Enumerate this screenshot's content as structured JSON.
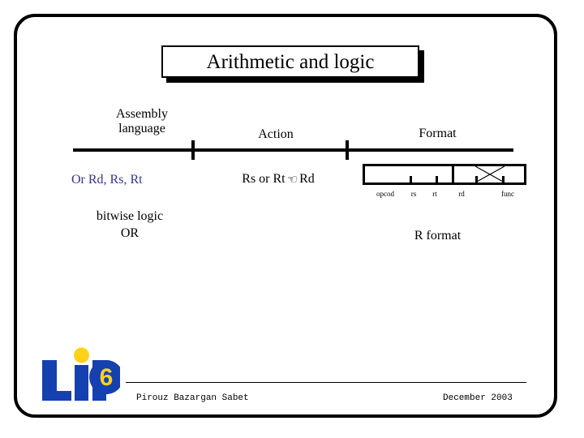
{
  "slide": {
    "title": "Arithmetic and logic",
    "headers": {
      "assembly": "Assembly\nlanguage",
      "assembly_line1": "Assembly",
      "assembly_line2": "language",
      "action": "Action",
      "format": "Format"
    },
    "row": {
      "assembly_instruction": "Or Rd, Rs, Rt",
      "action_left": "Rs or Rt",
      "action_arrow": "☜",
      "action_right": "Rd",
      "meaning_line1": "bitwise logic",
      "meaning_line2": "OR",
      "format_name": "R format"
    },
    "instruction_format": {
      "fields": [
        "opcod",
        "rs",
        "rt",
        "rd",
        "func"
      ],
      "crossed_out_field": "rd"
    },
    "footer": {
      "author": "Pirouz Bazargan Sabet",
      "date": "December 2003"
    },
    "logo": {
      "name": "LIP6",
      "letters": "LIP",
      "digit": "6",
      "blue": "#1540b0",
      "yellow": "#ffd21a"
    },
    "colors": {
      "accent_blue": "#353590",
      "text_black": "#000000",
      "background": "#ffffff"
    }
  }
}
